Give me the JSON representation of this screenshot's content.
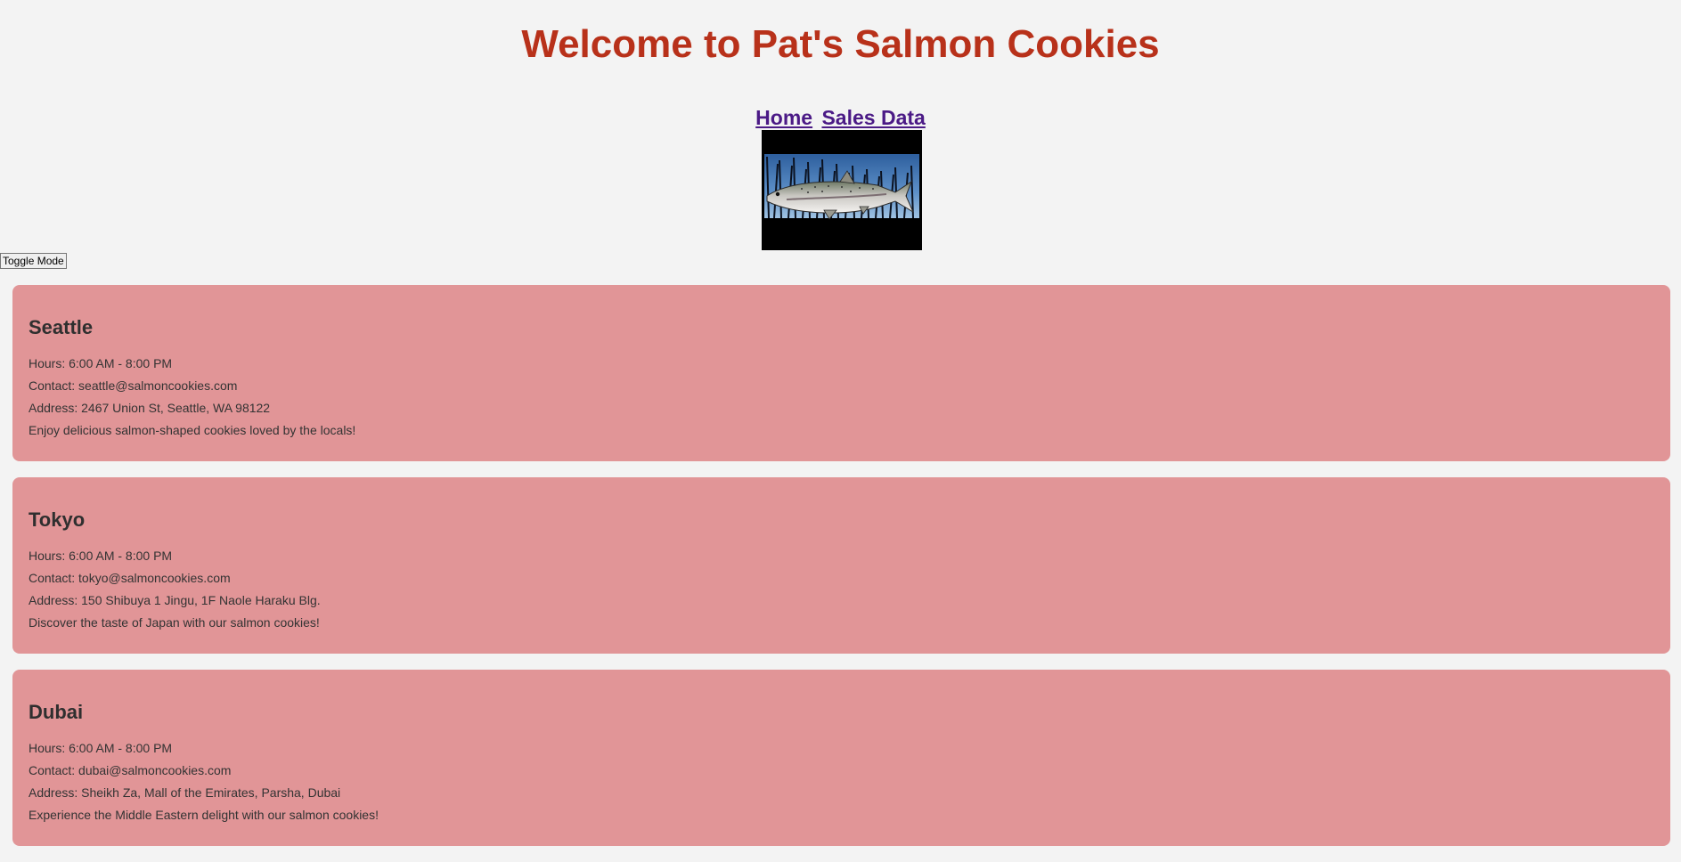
{
  "header": {
    "title": "Welcome to Pat's Salmon Cookies"
  },
  "nav": {
    "home": "Home",
    "sales_data": "Sales Data"
  },
  "controls": {
    "toggle_label": "Toggle Mode"
  },
  "stores": [
    {
      "name": "Seattle",
      "hours": "Hours: 6:00 AM - 8:00 PM",
      "contact": "Contact: seattle@salmoncookies.com",
      "address": "Address: 2467 Union St, Seattle, WA 98122",
      "description": "Enjoy delicious salmon-shaped cookies loved by the locals!"
    },
    {
      "name": "Tokyo",
      "hours": "Hours: 6:00 AM - 8:00 PM",
      "contact": "Contact: tokyo@salmoncookies.com",
      "address": "Address: 150 Shibuya 1 Jingu, 1F Naole Haraku Blg.",
      "description": "Discover the taste of Japan with our salmon cookies!"
    },
    {
      "name": "Dubai",
      "hours": "Hours: 6:00 AM - 8:00 PM",
      "contact": "Contact: dubai@salmoncookies.com",
      "address": "Address: Sheikh Za, Mall of the Emirates, Parsha, Dubai",
      "description": "Experience the Middle Eastern delight with our salmon cookies!"
    }
  ],
  "theme": {
    "title_color": "#b8311a",
    "link_color": "#4b1a86",
    "card_color": "#e19597",
    "page_bg": "#f3f3f3"
  }
}
